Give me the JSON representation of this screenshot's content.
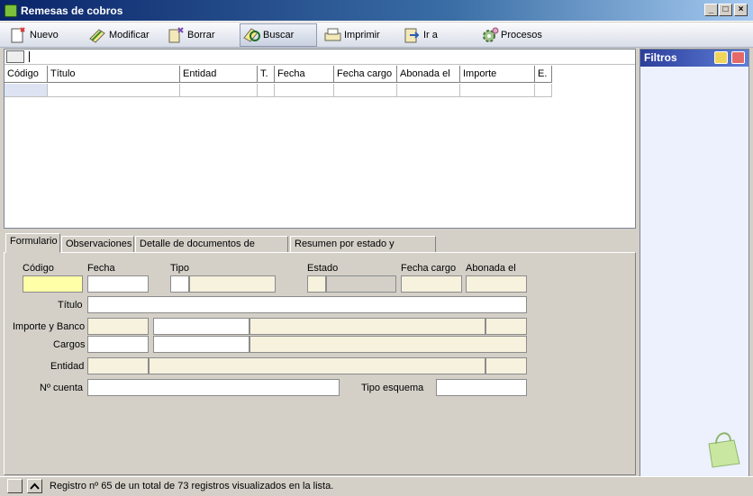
{
  "window": {
    "title": "Remesas de cobros",
    "minimize": "_",
    "maximize": "□",
    "close": "×"
  },
  "toolbar": {
    "buttons": [
      {
        "label": "Nuevo",
        "icon": "new-icon"
      },
      {
        "label": "Modificar",
        "icon": "edit-icon"
      },
      {
        "label": "Borrar",
        "icon": "delete-icon"
      },
      {
        "label": "Buscar",
        "icon": "search-icon"
      },
      {
        "label": "Imprimir",
        "icon": "print-icon"
      },
      {
        "label": "Ir a",
        "icon": "goto-icon"
      },
      {
        "label": "Procesos",
        "icon": "gear-icon"
      }
    ]
  },
  "grid": {
    "columns": [
      "Código",
      "Título",
      "Entidad",
      "T.",
      "Fecha",
      "Fecha cargo",
      "Abonada el",
      "Importe",
      "E."
    ]
  },
  "filters": {
    "title": "Filtros"
  },
  "tabs": [
    "Formulario",
    "Observaciones",
    "Detalle de documentos de cartera",
    "Resumen por estado y contacto"
  ],
  "form": {
    "codigo": "Código",
    "fecha": "Fecha",
    "tipo": "Tipo",
    "estado": "Estado",
    "fecha_cargo": "Fecha cargo",
    "abonada_el": "Abonada el",
    "titulo": "Título",
    "importe_banco": "Importe y Banco",
    "cargos": "Cargos",
    "entidad": "Entidad",
    "n_cuenta": "Nº cuenta",
    "tipo_esquema": "Tipo esquema"
  },
  "status": {
    "text": "Registro nº 65 de un total de 73 registros visualizados en la lista."
  },
  "colors": {
    "title_bar": "#0a246a",
    "filters_bg": "#ecf1fd",
    "field_bg": "#f6f2de",
    "focus_field": "#ffffa8"
  }
}
